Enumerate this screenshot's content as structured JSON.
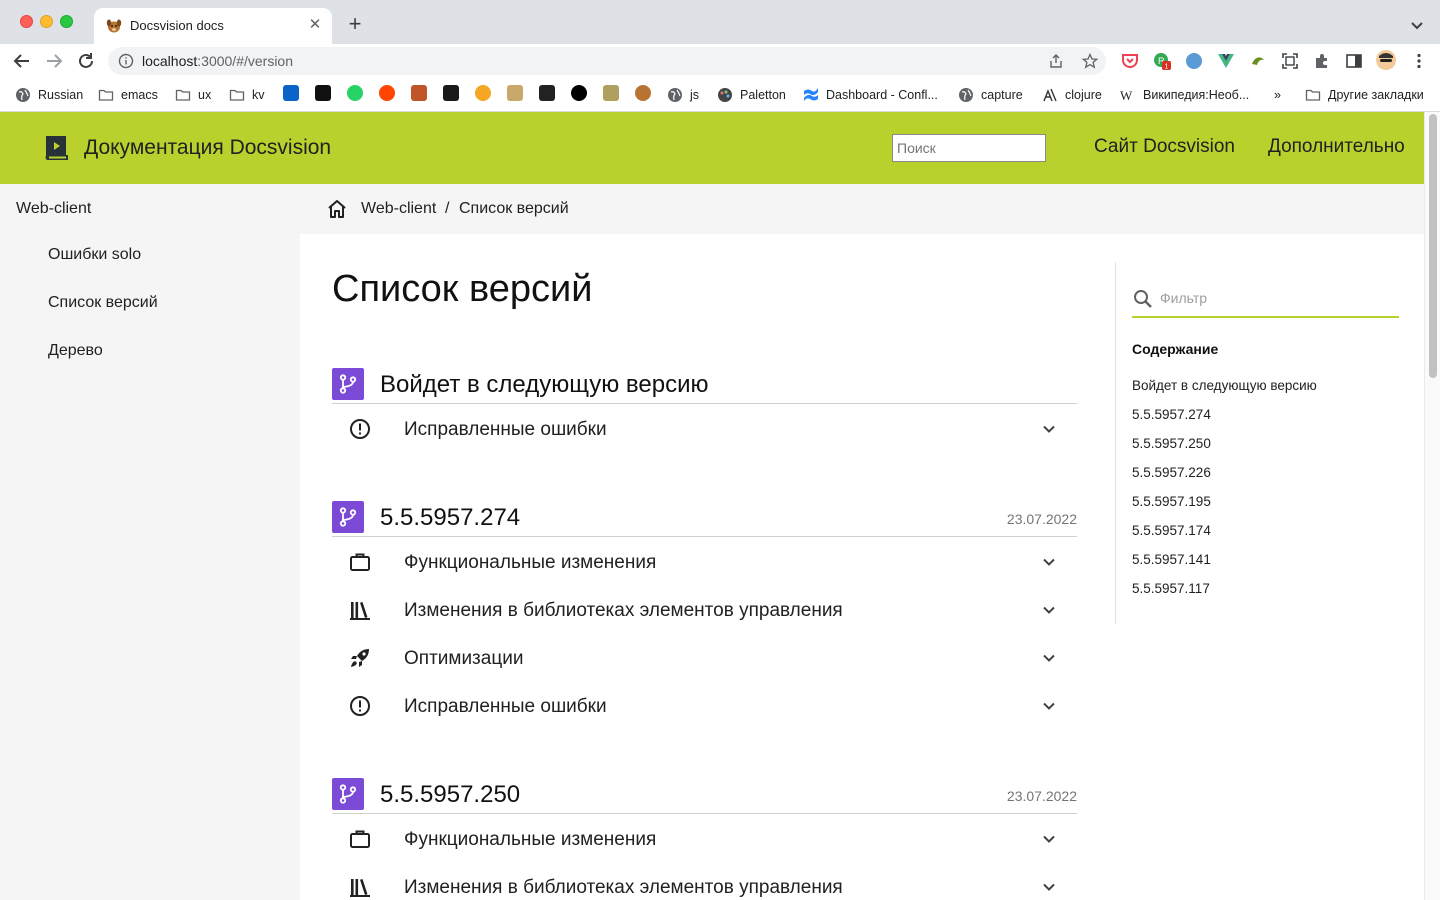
{
  "browser": {
    "tab_title": "Docsvision docs",
    "url_host": "localhost",
    "url_rest": ":3000/#/version",
    "bookmarks": [
      {
        "label": "Russian",
        "icon": "globe-icon"
      },
      {
        "label": "emacs",
        "icon": "folder-icon"
      },
      {
        "label": "ux",
        "icon": "folder-icon"
      },
      {
        "label": "kv",
        "icon": "folder-icon"
      },
      {
        "label": "js",
        "icon": "globe-icon"
      },
      {
        "label": "Paletton",
        "icon": "palette-icon"
      },
      {
        "label": "Dashboard - Confl...",
        "icon": "confluence-icon"
      },
      {
        "label": "capture",
        "icon": "globe-icon"
      },
      {
        "label": "clojure",
        "icon": "clojure-icon"
      },
      {
        "label": "Википедия:Необ...",
        "icon": "wikipedia-icon"
      },
      {
        "label": "Другие закладки",
        "icon": "folder-icon"
      }
    ],
    "overflow_label": "»"
  },
  "header": {
    "site_title": "Документация Docsvision",
    "search_placeholder": "Поиск",
    "links": [
      "Сайт Docsvision",
      "Дополнительно"
    ],
    "accent_color": "#bad12d"
  },
  "sidebar": {
    "root": "Web-client",
    "items": [
      "Ошибки solo",
      "Список версий",
      "Дерево"
    ]
  },
  "breadcrumb": {
    "items": [
      "Web-client",
      "Список версий"
    ],
    "separator": "/"
  },
  "main": {
    "title": "Список версий",
    "badge_color": "#7b4bd8",
    "versions": [
      {
        "title": "Войдет в следующую версию",
        "date": "",
        "sections": [
          {
            "label": "Исправленные ошибки",
            "icon": "alert-circle-icon"
          }
        ]
      },
      {
        "title": "5.5.5957.274",
        "date": "23.07.2022",
        "sections": [
          {
            "label": "Функциональные изменения",
            "icon": "briefcase-icon"
          },
          {
            "label": "Изменения в библиотеках элементов управления",
            "icon": "library-icon"
          },
          {
            "label": "Оптимизации",
            "icon": "rocket-icon"
          },
          {
            "label": "Исправленные ошибки",
            "icon": "alert-circle-icon"
          }
        ]
      },
      {
        "title": "5.5.5957.250",
        "date": "23.07.2022",
        "sections": [
          {
            "label": "Функциональные изменения",
            "icon": "briefcase-icon"
          },
          {
            "label": "Изменения в библиотеках элементов управления",
            "icon": "library-icon"
          }
        ]
      }
    ]
  },
  "toc": {
    "filter_placeholder": "Фильтр",
    "title": "Содержание",
    "items": [
      "Войдет в следующую версию",
      "5.5.5957.274",
      "5.5.5957.250",
      "5.5.5957.226",
      "5.5.5957.195",
      "5.5.5957.174",
      "5.5.5957.141",
      "5.5.5957.117"
    ]
  }
}
